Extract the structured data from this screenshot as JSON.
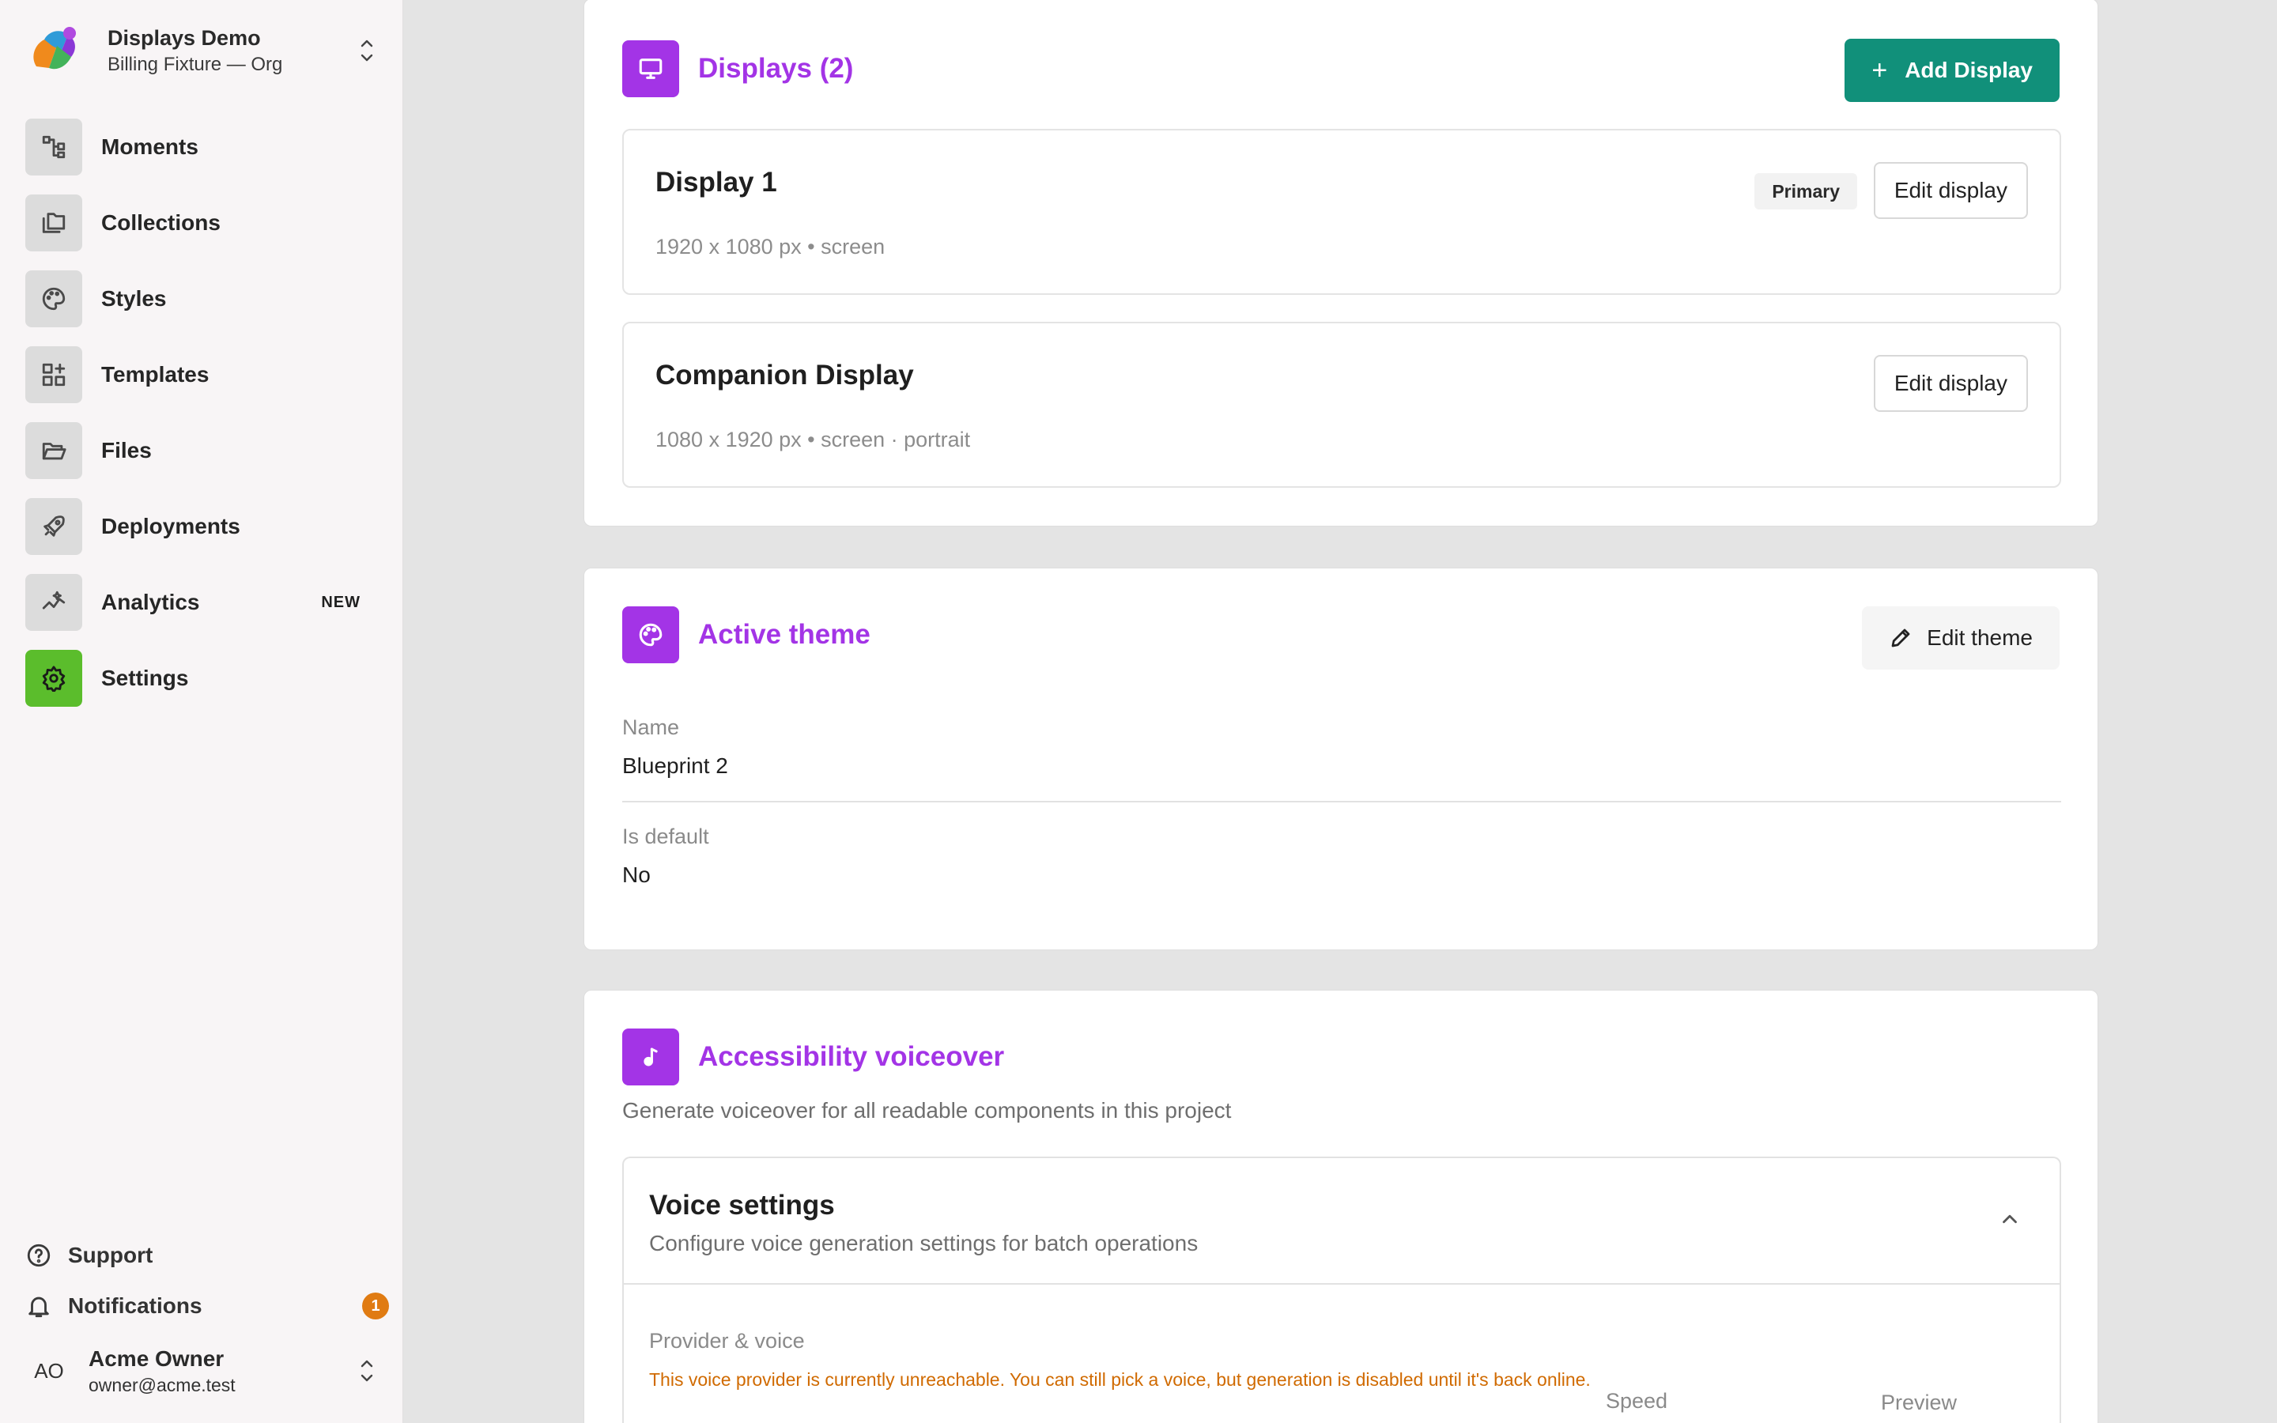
{
  "org": {
    "name": "Displays Demo",
    "subtitle": "Billing Fixture — Org"
  },
  "sidebar": {
    "items": [
      {
        "label": "Moments",
        "icon": "workflow-icon"
      },
      {
        "label": "Collections",
        "icon": "collections-icon"
      },
      {
        "label": "Styles",
        "icon": "palette-icon"
      },
      {
        "label": "Templates",
        "icon": "templates-icon"
      },
      {
        "label": "Files",
        "icon": "folder-open-icon"
      },
      {
        "label": "Deployments",
        "icon": "rocket-icon"
      },
      {
        "label": "Analytics",
        "icon": "analytics-icon",
        "badge": "NEW"
      },
      {
        "label": "Settings",
        "icon": "gear-icon",
        "active": true
      }
    ],
    "active_color": "#5bbd2c"
  },
  "footer": {
    "support_label": "Support",
    "notifications_label": "Notifications",
    "notifications_count": "1",
    "user": {
      "initials": "AO",
      "name": "Acme Owner",
      "email": "owner@acme.test"
    }
  },
  "displays": {
    "title": "Displays (2)",
    "add_label": "Add Display",
    "items": [
      {
        "name": "Display 1",
        "meta": "1920 x 1080 px • screen",
        "badge": "Primary",
        "edit_label": "Edit display"
      },
      {
        "name": "Companion Display",
        "meta": "1080 x 1920 px • screen · portrait",
        "edit_label": "Edit display"
      }
    ]
  },
  "theme": {
    "title": "Active theme",
    "edit_label": "Edit theme",
    "fields": [
      {
        "label": "Name",
        "value": "Blueprint 2"
      },
      {
        "label": "Is default",
        "value": "No"
      }
    ]
  },
  "voiceover": {
    "title": "Accessibility voiceover",
    "subtitle": "Generate voiceover for all readable components in this project",
    "settings": {
      "title": "Voice settings",
      "subtitle": "Configure voice generation settings for batch operations",
      "provider_label": "Provider & voice",
      "warning": "This voice provider is currently unreachable. You can still pick a voice, but generation is disabled until it's back online.",
      "speed_label": "Speed",
      "preview_label": "Preview"
    }
  },
  "colors": {
    "accent": "#a334e6",
    "primary_button": "#11907a",
    "warning": "#d06a00",
    "badge": "#e07b12"
  }
}
